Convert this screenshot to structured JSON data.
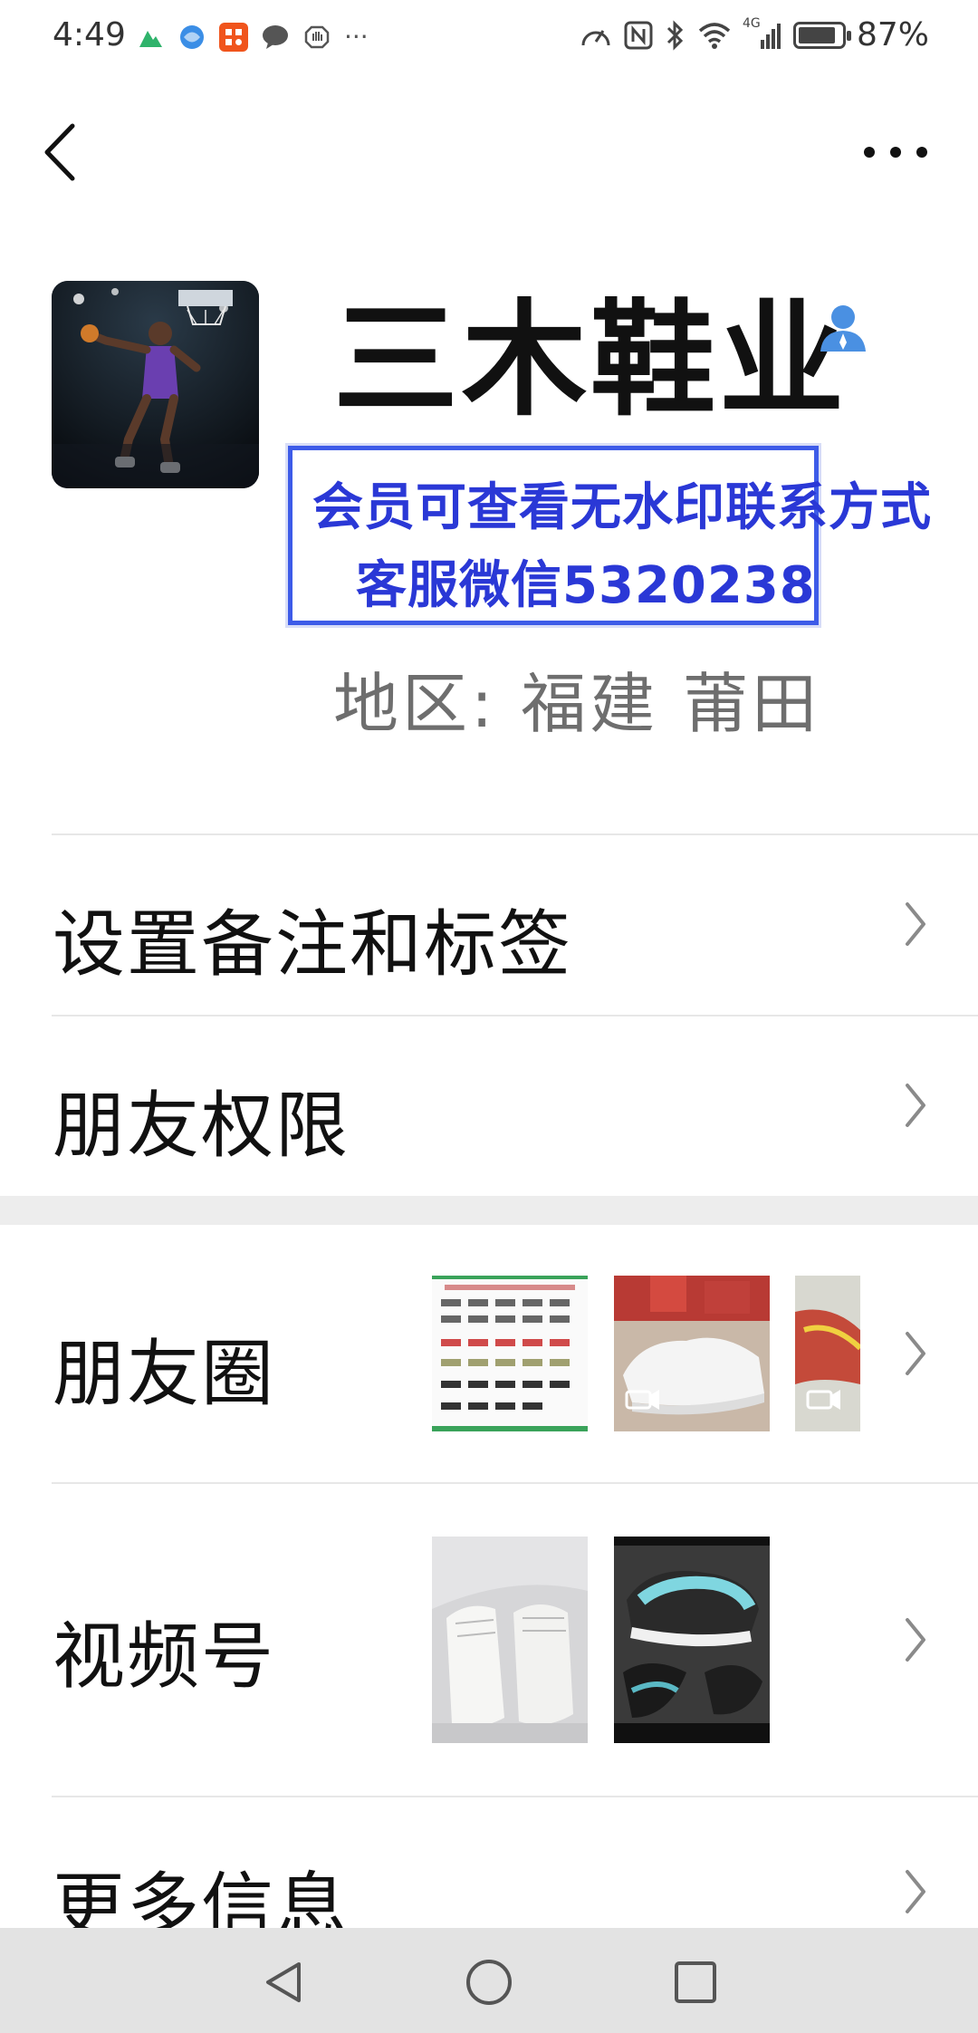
{
  "status_bar": {
    "time": "4:49",
    "left_icons": [
      "maps-icon",
      "browser-icon",
      "app-icon",
      "chat-bubble-icon",
      "hand-icon",
      "more-dots"
    ],
    "overflow": "···",
    "network": "4G",
    "battery_percent": "87%",
    "battery_level": 0.87
  },
  "header": {
    "back_label": "back",
    "more_label": "more"
  },
  "profile": {
    "name": "三木鞋业",
    "watermark_line1": "会员可查看无水印联系方式",
    "watermark_line2": "客服微信5320238",
    "region": "地区: 福建  莆田"
  },
  "menu": {
    "remark_tags": "设置备注和标签",
    "friend_permissions": "朋友权限",
    "moments": "朋友圈",
    "channels": "视频号",
    "more_info": "更多信息"
  },
  "colors": {
    "watermark_blue": "#2a38d6",
    "contact_icon_blue": "#4a90e2",
    "divider": "#e7e7e7",
    "section_gap": "#ededed",
    "nav_bar": "#e3e3e3"
  }
}
